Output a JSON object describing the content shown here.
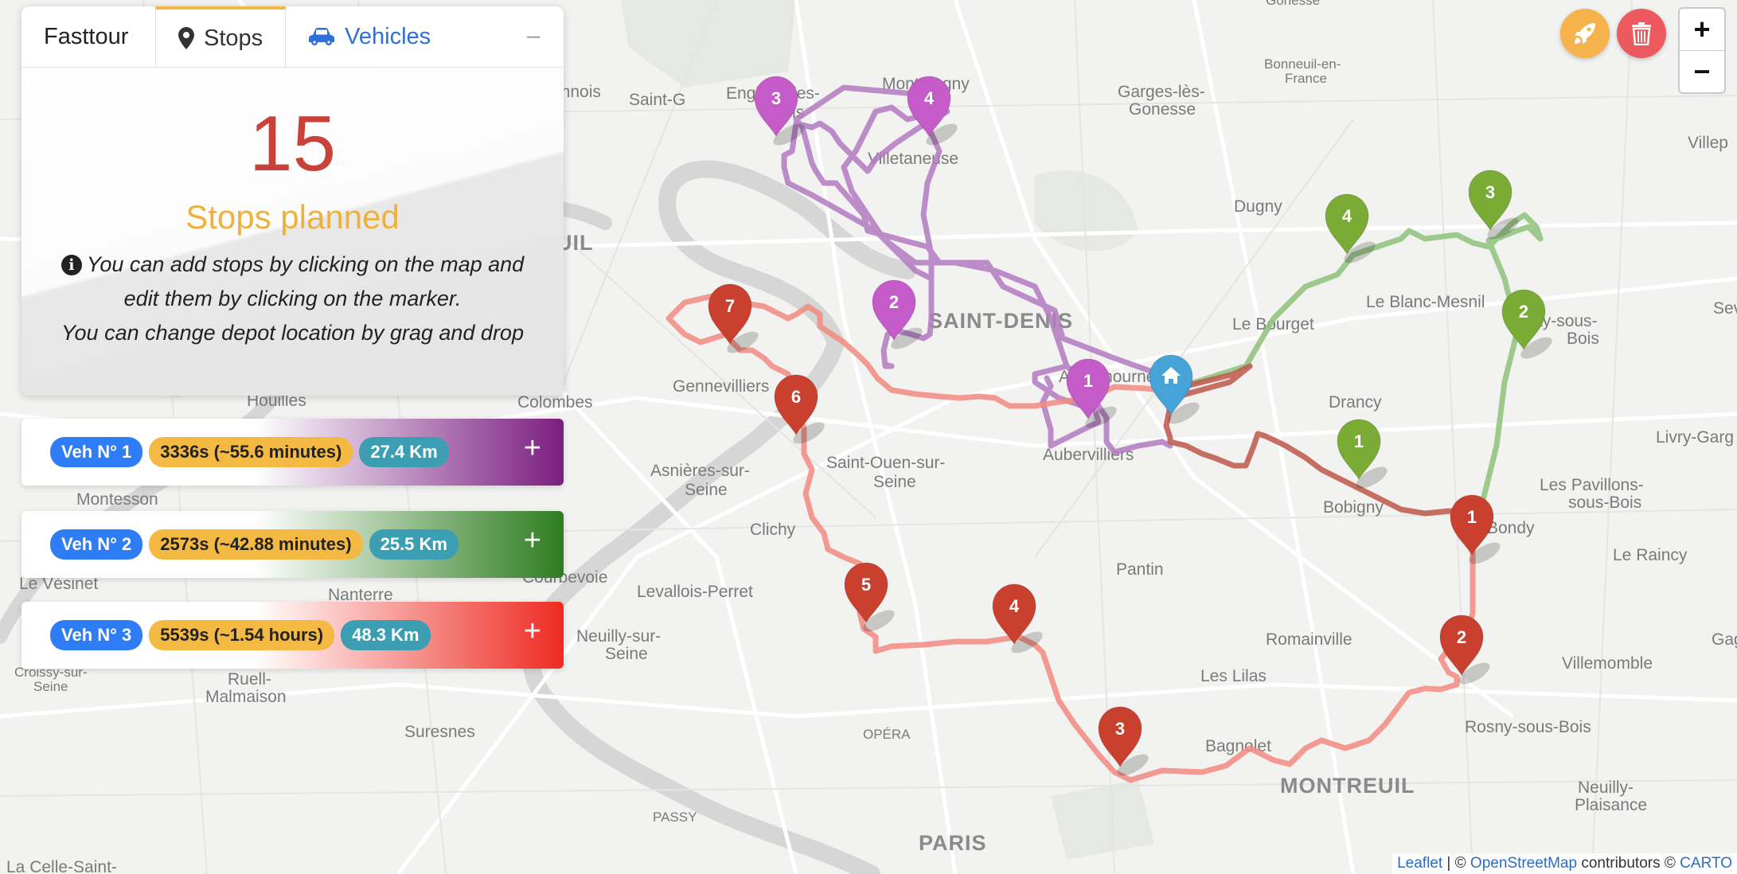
{
  "app": {
    "title": "Fasttour"
  },
  "tabs": [
    {
      "label": "Stops",
      "icon": "map-marker-icon",
      "active": true
    },
    {
      "label": "Vehicles",
      "icon": "car-icon",
      "active": false
    }
  ],
  "collapse_symbol": "−",
  "summary": {
    "count": "15",
    "caption": "Stops planned",
    "help_line_1": "You can add stops by clicking on the map and",
    "help_line_2": "edit them by clicking on the marker.",
    "help_line_3": "You can change depot location by grag and drop"
  },
  "vehicles": [
    {
      "name": "Veh N° 1",
      "duration": "3336s (~55.6 minutes)",
      "distance": "27.4 Km",
      "color": "#7a1e80",
      "add": "+"
    },
    {
      "name": "Veh N° 2",
      "duration": "2573s (~42.88 minutes)",
      "distance": "25.5 Km",
      "color": "#2e7d20",
      "add": "+"
    },
    {
      "name": "Veh N° 3",
      "duration": "5539s (~1.54 hours)",
      "distance": "48.3 Km",
      "color": "#ee2b22",
      "add": "+"
    }
  ],
  "controls": {
    "optimize_icon": "rocket-icon",
    "optimize_color": "#f7b34b",
    "delete_icon": "trash-icon",
    "delete_color": "#ec5a5f",
    "zoom_in": "+",
    "zoom_out": "−"
  },
  "map": {
    "places": [
      "Gonesse",
      "Bonneuil-en-",
      "France",
      "Saint-G",
      "Enghien-les-",
      "ns",
      "Montmagny",
      "Garges-lès-",
      "Gonesse",
      "Villep",
      "Villetaneuse",
      "Dugny",
      "EUIL",
      "Le Blanc-Mesnil",
      "Sevran",
      "SAINT-DENIS",
      "Le Bourget",
      "ulnay-sous-",
      "Bois",
      "Gennevilliers",
      "Drancy",
      "Houilles",
      "Colombes",
      "Aubervilliers",
      "Saint-Ouen-sur-",
      "Seine",
      "Asnières-sur-",
      "Seine",
      "Livry-Garg",
      "Bobigny",
      "Les Pavillons-",
      "sous-Bois",
      "Bondy",
      "Montesson",
      "Clichy",
      "Le Raincy",
      "Le Vésinet",
      "Nanterre",
      "Courbevoie",
      "Levallois-Perret",
      "Pantin",
      "Neuilly-sur-",
      "Seine",
      "Romainville",
      "Villemomble",
      "Croissy-sur-",
      "Seine",
      "Ruell-",
      "Malmaison",
      "Les Lilas",
      "Suresnes",
      "OPÉRA",
      "Bagnolet",
      "Rosny-sous-Bois",
      "MONTREUIL",
      "Neuilly-",
      "Plaisance",
      "PASSY",
      "PARIS",
      "La Celle-Saint-",
      "Aubernourne",
      "Gag",
      "innois"
    ],
    "vehicle_colors": {
      "v1": "#b27ac0",
      "v2": "#8fc27a",
      "v3": "#f28a80",
      "v3_dark": "#c0574a"
    },
    "markers": {
      "v1": [
        "1",
        "2",
        "3",
        "4"
      ],
      "v2": [
        "1",
        "2",
        "3",
        "4"
      ],
      "v3": [
        "1",
        "2",
        "3",
        "4",
        "5",
        "6",
        "7"
      ]
    },
    "marker_colors": {
      "v1": "#c45bc8",
      "v2": "#7aab35",
      "v3": "#c9402f",
      "depot": "#46a3d8"
    },
    "depot_icon": "home-icon"
  },
  "attribution": {
    "leaflet": "Leaflet",
    "sep": " | © ",
    "osm": "OpenStreetMap",
    "mid": " contributors © ",
    "carto": "CARTO"
  }
}
